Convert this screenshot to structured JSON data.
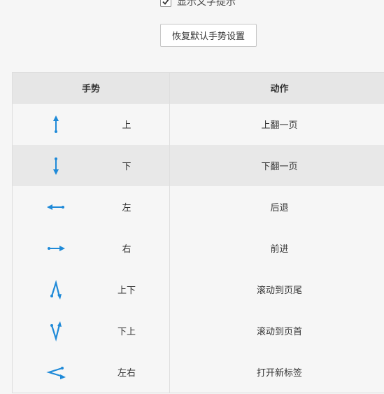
{
  "settings": {
    "show_text_hint_label": "显示文字提示",
    "show_text_hint_checked": true,
    "reset_button_label": "恢复默认手势设置"
  },
  "table": {
    "headers": {
      "gesture": "手势",
      "action": "动作"
    },
    "rows": [
      {
        "gesture": "上",
        "action": "上翻一页",
        "icon": "arrow-up-icon"
      },
      {
        "gesture": "下",
        "action": "下翻一页",
        "icon": "arrow-down-icon"
      },
      {
        "gesture": "左",
        "action": "后退",
        "icon": "arrow-left-icon"
      },
      {
        "gesture": "右",
        "action": "前进",
        "icon": "arrow-right-icon"
      },
      {
        "gesture": "上下",
        "action": "滚动到页尾",
        "icon": "up-down-gesture-icon"
      },
      {
        "gesture": "下上",
        "action": "滚动到页首",
        "icon": "down-up-gesture-icon"
      },
      {
        "gesture": "左右",
        "action": "打开新标签",
        "icon": "left-right-gesture-icon"
      }
    ]
  },
  "colors": {
    "icon_blue": "#1f8ad8",
    "header_bg": "#e6e6e6",
    "alt_row_bg": "#e8e8e8"
  }
}
